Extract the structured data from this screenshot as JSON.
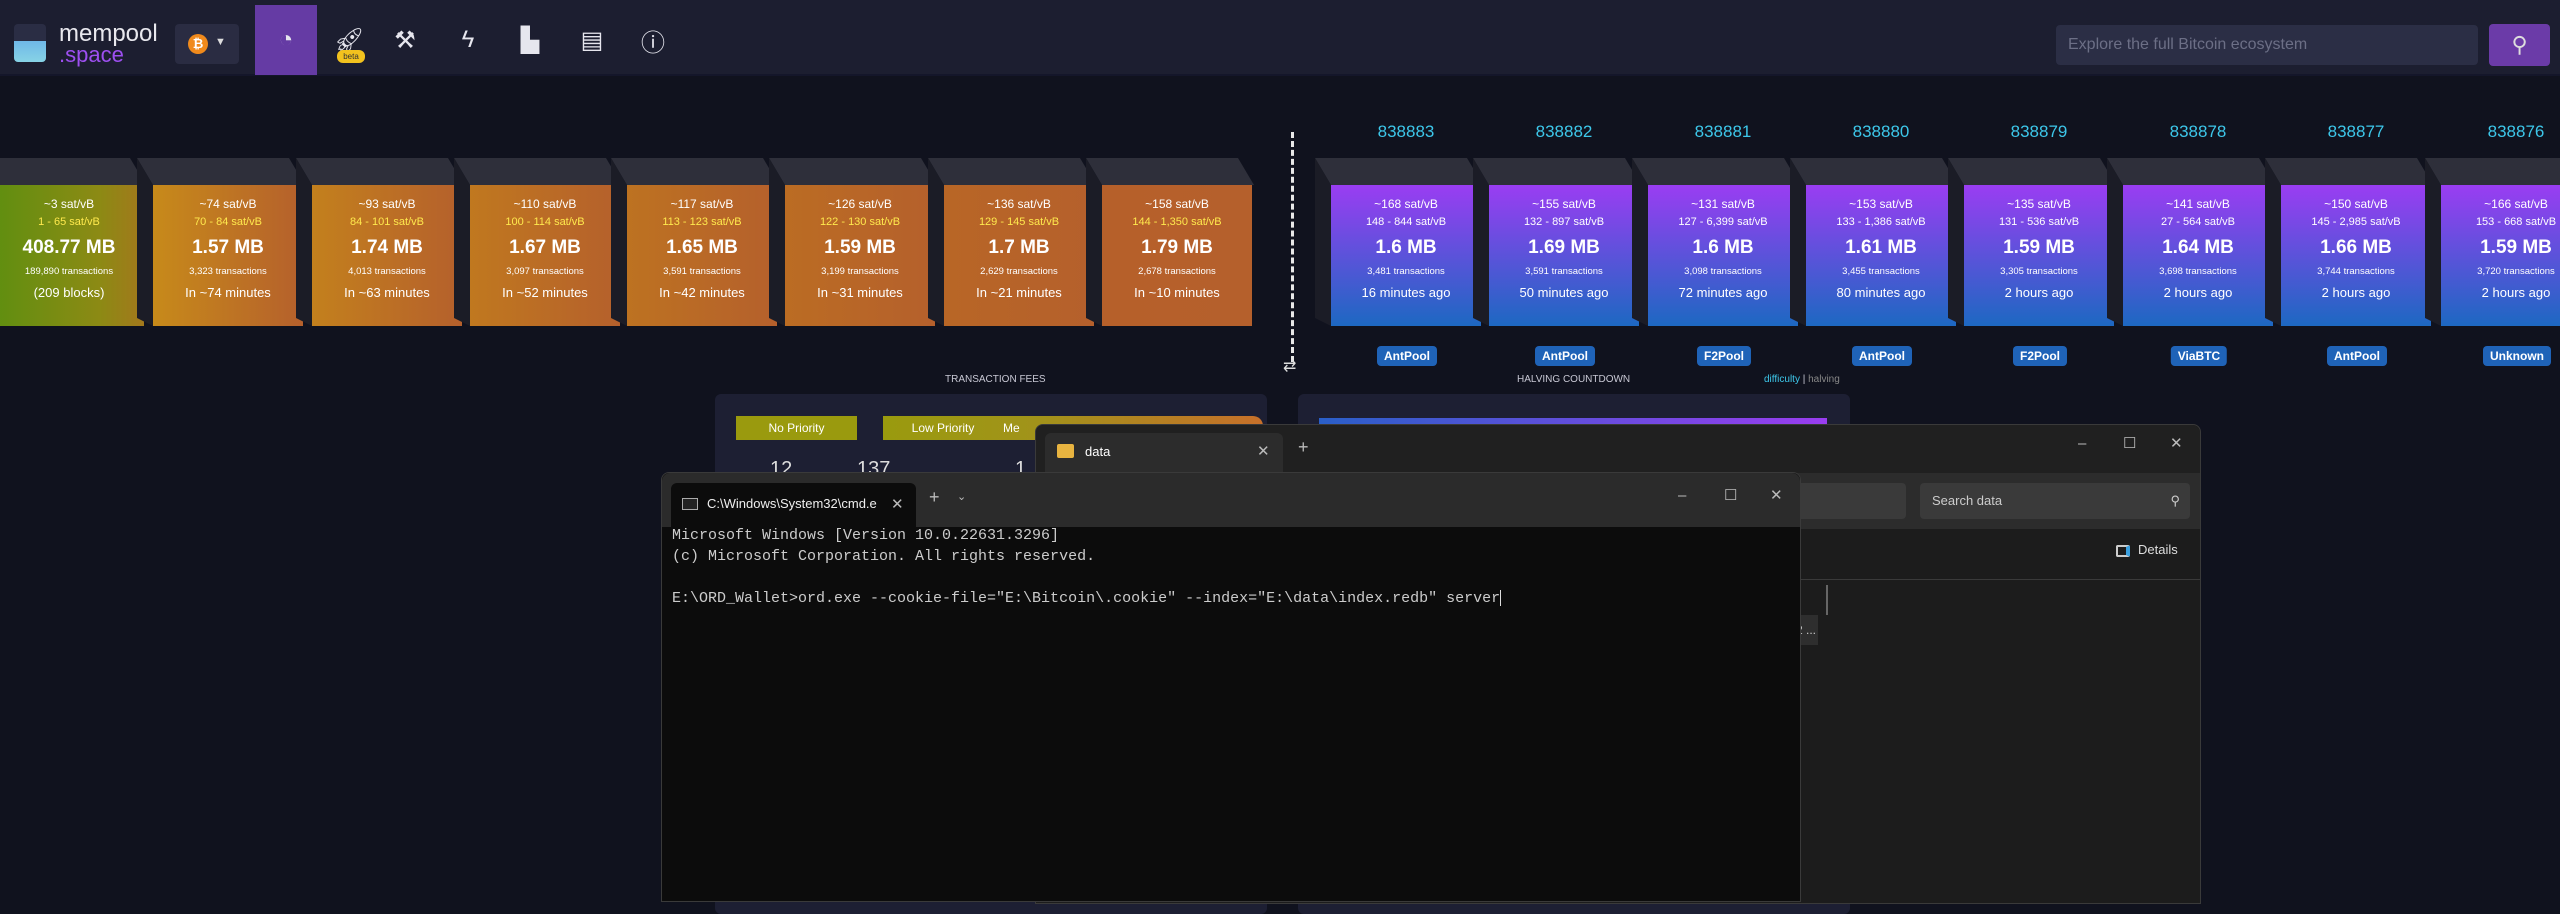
{
  "header": {
    "logo": {
      "line1": "mempool",
      "line2": ".space"
    },
    "network_icon": "bitcoin-icon",
    "nav": [
      {
        "name": "dashboard",
        "icon": "gauge-icon",
        "active": true
      },
      {
        "name": "accelerator",
        "icon": "rocket-icon",
        "badge": "beta"
      },
      {
        "name": "mining",
        "icon": "hammer-icon"
      },
      {
        "name": "lightning",
        "icon": "lightning-icon"
      },
      {
        "name": "graphs",
        "icon": "chart-icon"
      },
      {
        "name": "docs",
        "icon": "book-icon"
      },
      {
        "name": "about",
        "icon": "info-icon"
      }
    ],
    "search_placeholder": "Explore the full Bitcoin ecosystem",
    "accent": "#653ba4"
  },
  "mempool_blocks": [
    {
      "fee": "~3 sat/vB",
      "range": "1 - 65 sat/vB",
      "size": "408.77 MB",
      "tx": "189,890 transactions",
      "time": "(209 blocks)"
    },
    {
      "fee": "~74 sat/vB",
      "range": "70 - 84 sat/vB",
      "size": "1.57 MB",
      "tx": "3,323 transactions",
      "time": "In ~74 minutes"
    },
    {
      "fee": "~93 sat/vB",
      "range": "84 - 101 sat/vB",
      "size": "1.74 MB",
      "tx": "4,013 transactions",
      "time": "In ~63 minutes"
    },
    {
      "fee": "~110 sat/vB",
      "range": "100 - 114 sat/vB",
      "size": "1.67 MB",
      "tx": "3,097 transactions",
      "time": "In ~52 minutes"
    },
    {
      "fee": "~117 sat/vB",
      "range": "113 - 123 sat/vB",
      "size": "1.65 MB",
      "tx": "3,591 transactions",
      "time": "In ~42 minutes"
    },
    {
      "fee": "~126 sat/vB",
      "range": "122 - 130 sat/vB",
      "size": "1.59 MB",
      "tx": "3,199 transactions",
      "time": "In ~31 minutes"
    },
    {
      "fee": "~136 sat/vB",
      "range": "129 - 145 sat/vB",
      "size": "1.7 MB",
      "tx": "2,629 transactions",
      "time": "In ~21 minutes"
    },
    {
      "fee": "~158 sat/vB",
      "range": "144 - 1,350 sat/vB",
      "size": "1.79 MB",
      "tx": "2,678 transactions",
      "time": "In ~10 minutes"
    }
  ],
  "mined_blocks": [
    {
      "height": "838883",
      "fee": "~168 sat/vB",
      "range": "148 - 844 sat/vB",
      "size": "1.6 MB",
      "tx": "3,481 transactions",
      "time": "16 minutes ago",
      "pool": "AntPool"
    },
    {
      "height": "838882",
      "fee": "~155 sat/vB",
      "range": "132 - 897 sat/vB",
      "size": "1.69 MB",
      "tx": "3,591 transactions",
      "time": "50 minutes ago",
      "pool": "AntPool"
    },
    {
      "height": "838881",
      "fee": "~131 sat/vB",
      "range": "127 - 6,399 sat/vB",
      "size": "1.6 MB",
      "tx": "3,098 transactions",
      "time": "72 minutes ago",
      "pool": "F2Pool"
    },
    {
      "height": "838880",
      "fee": "~153 sat/vB",
      "range": "133 - 1,386 sat/vB",
      "size": "1.61 MB",
      "tx": "3,455 transactions",
      "time": "80 minutes ago",
      "pool": "AntPool"
    },
    {
      "height": "838879",
      "fee": "~135 sat/vB",
      "range": "131 - 536 sat/vB",
      "size": "1.59 MB",
      "tx": "3,305 transactions",
      "time": "2 hours ago",
      "pool": "F2Pool"
    },
    {
      "height": "838878",
      "fee": "~141 sat/vB",
      "range": "27 - 564 sat/vB",
      "size": "1.64 MB",
      "tx": "3,698 transactions",
      "time": "2 hours ago",
      "pool": "ViaBTC"
    },
    {
      "height": "838877",
      "fee": "~150 sat/vB",
      "range": "145 - 2,985 sat/vB",
      "size": "1.66 MB",
      "tx": "3,744 transactions",
      "time": "2 hours ago",
      "pool": "AntPool"
    },
    {
      "height": "838876",
      "fee": "~166 sat/vB",
      "range": "153 - 668 sat/vB",
      "size": "1.59 MB",
      "tx": "3,720 transactions",
      "time": "2 hours ago",
      "pool": "Unknown"
    }
  ],
  "fees": {
    "title": "TRANSACTION FEES",
    "no_priority": "No Priority",
    "low_priority": "Low Priority",
    "medium_priority_partial": "Me",
    "values": [
      "12",
      "137",
      "1"
    ]
  },
  "halving": {
    "title": "HALVING COUNTDOWN",
    "toggle_difficulty": "difficulty",
    "toggle_sep": " | ",
    "toggle_halving": "halving"
  },
  "explorer": {
    "tab": "data",
    "search_placeholder": "Search data",
    "details": "Details",
    "more": "2 ..."
  },
  "cmd": {
    "tab": "C:\\Windows\\System32\\cmd.e",
    "lines": [
      "Microsoft Windows [Version 10.0.22631.3296]",
      "(c) Microsoft Corporation. All rights reserved.",
      "",
      "E:\\ORD_Wallet>ord.exe --cookie-file=\"E:\\Bitcoin\\.cookie\" --index=\"E:\\data\\index.redb\" server"
    ]
  }
}
